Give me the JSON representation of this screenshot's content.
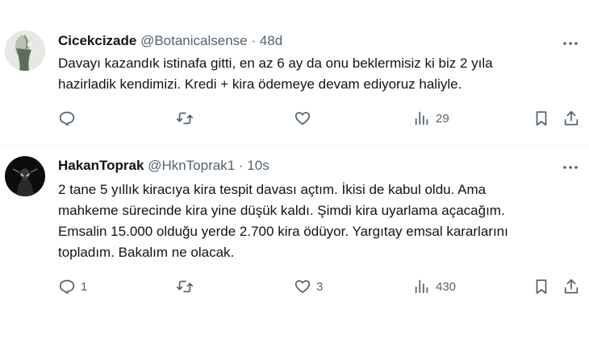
{
  "tweets": [
    {
      "author_name": "Cicekcizade",
      "handle": "@Botanicalsense",
      "separator": "·",
      "time": "48d",
      "text_lines": [
        "Davayı kazandık istinafa gitti, en az 6 ay da onu beklermisiz ki biz 2 yıla",
        "hazirladik kendimizi. Kredi + kira ödemeye devam ediyoruz haliyle."
      ],
      "reply_count": "",
      "retweet_count": "",
      "like_count": "",
      "view_count": "29"
    },
    {
      "author_name": "HakanToprak",
      "handle": "@HknToprak1",
      "separator": "·",
      "time": "10s",
      "text_lines": [
        "2 tane 5 yıllık kiracıya kira tespit davası açtım. İkisi de kabul oldu. Ama",
        "mahkeme sürecinde kira yine düşük kaldı. Şimdi kira uyarlama açacağım.",
        "Emsalin 15.000 olduğu yerde 2.700 kira ödüyor. Yargıtay emsal kararlarını",
        "topladım. Bakalım ne olacak."
      ],
      "reply_count": "1",
      "retweet_count": "",
      "like_count": "3",
      "view_count": "430"
    }
  ],
  "icons": {
    "reply": "reply-icon",
    "retweet": "retweet-icon",
    "like": "heart-icon",
    "views": "views-bar-chart-icon",
    "bookmark": "bookmark-icon",
    "share": "share-upload-icon",
    "more": "more-options-icon"
  },
  "colors": {
    "text": "#0f1419",
    "secondary": "#536471",
    "divider": "#eff3f4"
  }
}
